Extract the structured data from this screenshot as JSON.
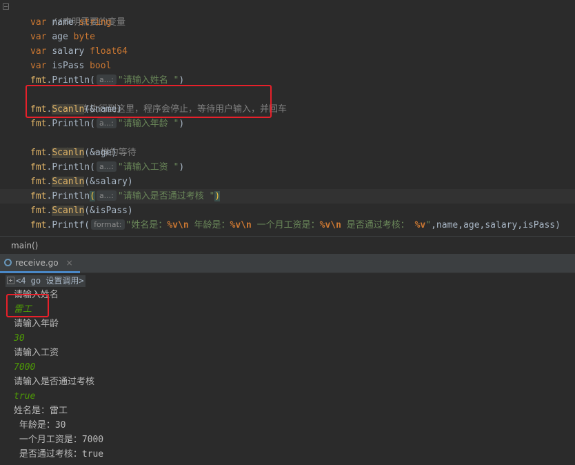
{
  "editor": {
    "lines": [
      {
        "comment": "//声明需要的变量"
      },
      {
        "kw": "var",
        "name": "name",
        "type": "string"
      },
      {
        "kw": "var",
        "name": "age",
        "type": "byte"
      },
      {
        "kw": "var",
        "name": "salary",
        "type": "float64"
      },
      {
        "kw": "var",
        "name": "isPass",
        "type": "bool"
      },
      {
        "pkg": "fmt",
        "func": "Println",
        "hint": "a...:",
        "arg": "\"请输入姓名 \"",
        "close": ")"
      },
      {
        "comment": "//当程序执行到这里，程序会停止，等待用户输入，并回车"
      },
      {
        "pkg": "fmt",
        "func": "Scanln",
        "arg": "(&name)"
      },
      {
        "pkg": "fmt",
        "func": "Println",
        "hint": "a...:",
        "arg": "\"请输入年龄 \"",
        "close": ")"
      },
      {
        "comment": "//类似  一样的等待"
      },
      {
        "pkg": "fmt",
        "func": "Scanln",
        "arg": "(&age)"
      },
      {
        "pkg": "fmt",
        "func": "Println",
        "hint": "a...:",
        "arg": "\"请输入工资 \"",
        "close": ")"
      },
      {
        "pkg": "fmt",
        "func": "Scanln",
        "arg": "(&salary)"
      },
      {
        "pkg": "fmt",
        "func": "Println",
        "hint": "a...:",
        "arg": "\"请输入是否通过考核 \"",
        "close": ")"
      },
      {
        "pkg": "fmt",
        "func": "Scanln",
        "arg": "(&isPass)"
      },
      {
        "pkg": "fmt",
        "func": "Printf",
        "hint": "format:",
        "arg_parts": [
          "\"姓名是：",
          "%v\\n",
          " 年龄是：",
          "%v\\n",
          " 一个月工资是：",
          "%v\\n",
          " 是否通过考核： ",
          "%v",
          "\""
        ],
        "rest": ",name,age,salary,isPass)"
      }
    ]
  },
  "breadcrumb": {
    "label": "main()"
  },
  "run_tab": {
    "label": "receive.go",
    "close": "×"
  },
  "console": {
    "process_label": "<4 go 设置调用>",
    "lines": [
      {
        "text": "请输入姓名",
        "kind": "out"
      },
      {
        "text": "雷工",
        "kind": "in"
      },
      {
        "text": "请输入年龄",
        "kind": "out"
      },
      {
        "text": "30",
        "kind": "in"
      },
      {
        "text": "请输入工资",
        "kind": "out"
      },
      {
        "text": "7000",
        "kind": "in"
      },
      {
        "text": "请输入是否通过考核",
        "kind": "out"
      },
      {
        "text": "true",
        "kind": "in"
      },
      {
        "text": "姓名是：雷工",
        "kind": "out"
      },
      {
        "text": " 年龄是：30",
        "kind": "out"
      },
      {
        "text": " 一个月工资是：7000",
        "kind": "out"
      },
      {
        "text": " 是否通过考核：true",
        "kind": "out"
      }
    ]
  },
  "colors": {
    "highlight_box": "#e8202a",
    "input_text": "#4e9a06",
    "tab_underline": "#4a88c7"
  }
}
